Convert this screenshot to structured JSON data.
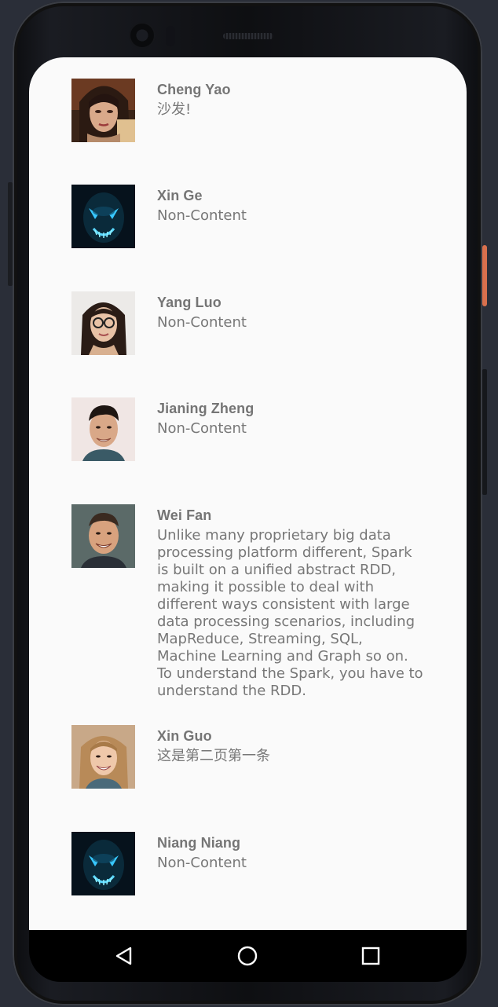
{
  "items": [
    {
      "name": "Cheng Yao",
      "text": "沙发!",
      "avatar": "woman-portrait-avatar"
    },
    {
      "name": "Xin Ge",
      "text": "Non-Content",
      "avatar": "glowing-mask-avatar"
    },
    {
      "name": "Yang Luo",
      "text": "Non-Content",
      "avatar": "woman-glasses-avatar"
    },
    {
      "name": "Jianing Zheng",
      "text": "Non-Content",
      "avatar": "young-man-avatar"
    },
    {
      "name": "Wei Fan",
      "text": "Unlike many proprietary big data processing platform different, Spark is built on a unified abstract RDD, making it possible to deal with different ways consistent with large data processing scenarios, including MapReduce, Streaming, SQL, Machine Learning and Graph so on. To understand the Spark, you have to understand the RDD.",
      "avatar": "smiling-man-avatar"
    },
    {
      "name": "Xin Guo",
      "text": "这是第二页第一条",
      "avatar": "smiling-woman-avatar"
    },
    {
      "name": "Niang Niang",
      "text": "Non-Content",
      "avatar": "glowing-mask-avatar"
    }
  ],
  "navbar": {
    "back": "back-icon",
    "home": "home-icon",
    "recents": "recents-icon"
  },
  "colors": {
    "screen_bg": "#fafafa",
    "name_text": "#757575",
    "body_text": "#777777",
    "power_button": "#d8704d"
  }
}
